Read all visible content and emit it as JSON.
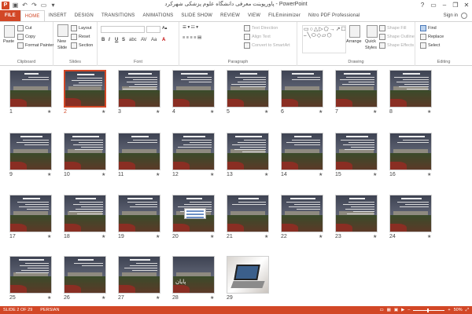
{
  "window": {
    "title": "پاورپوینت معرفی دانشگاه علوم پزشکی شهرکرد - PowerPoint",
    "app_logo": "P",
    "controls": [
      "?",
      "▭",
      "–",
      "❐",
      "✕"
    ]
  },
  "tabs": [
    "FILE",
    "HOME",
    "INSERT",
    "DESIGN",
    "TRANSITIONS",
    "ANIMATIONS",
    "SLIDE SHOW",
    "REVIEW",
    "VIEW",
    "FILEminimizer",
    "Nitro PDF Professional"
  ],
  "account": {
    "signin": "Sign in"
  },
  "ribbon": {
    "clipboard": {
      "label": "Clipboard",
      "paste": "Paste",
      "cut": "Cut",
      "copy": "Copy",
      "format_painter": "Format Painter"
    },
    "slides": {
      "label": "Slides",
      "new_slide": "New",
      "new_slide2": "Slide",
      "layout": "Layout",
      "reset": "Reset",
      "section": "Section"
    },
    "font": {
      "label": "Font",
      "bold": "B",
      "italic": "I",
      "underline": "U",
      "strike": "S",
      "shadow": "abc",
      "spacing": "AV",
      "case": "Aa",
      "color": "A"
    },
    "paragraph": {
      "label": "Paragraph",
      "text_direction": "Text Direction",
      "align_text": "Align Text",
      "convert_smartart": "Convert to SmartArt"
    },
    "drawing": {
      "label": "Drawing",
      "arrange": "Arrange",
      "quick_styles": "Quick",
      "quick_styles2": "Styles",
      "shape_fill": "Shape Fill",
      "shape_outline": "Shape Outline",
      "shape_effects": "Shape Effects"
    },
    "editing": {
      "label": "Editing",
      "find": "Find",
      "replace": "Replace",
      "select": "Select"
    }
  },
  "slides": [
    {
      "num": "1",
      "star": "★"
    },
    {
      "num": "2",
      "star": "★"
    },
    {
      "num": "3",
      "star": "★"
    },
    {
      "num": "4",
      "star": "★"
    },
    {
      "num": "5",
      "star": "★"
    },
    {
      "num": "6",
      "star": "★"
    },
    {
      "num": "7",
      "star": "★"
    },
    {
      "num": "8",
      "star": "★"
    },
    {
      "num": "9",
      "star": "★"
    },
    {
      "num": "10",
      "star": "★"
    },
    {
      "num": "11",
      "star": "★"
    },
    {
      "num": "12",
      "star": "★"
    },
    {
      "num": "13",
      "star": "★"
    },
    {
      "num": "14",
      "star": "★"
    },
    {
      "num": "15",
      "star": "★"
    },
    {
      "num": "16",
      "star": "★"
    },
    {
      "num": "17",
      "star": "★"
    },
    {
      "num": "18",
      "star": "★"
    },
    {
      "num": "19",
      "star": "★"
    },
    {
      "num": "20",
      "star": "★"
    },
    {
      "num": "21",
      "star": "★"
    },
    {
      "num": "22",
      "star": "★"
    },
    {
      "num": "23",
      "star": "★"
    },
    {
      "num": "24",
      "star": "★"
    },
    {
      "num": "25",
      "star": "★"
    },
    {
      "num": "26",
      "star": "★"
    },
    {
      "num": "27",
      "star": "★"
    },
    {
      "num": "28",
      "star": "★"
    },
    {
      "num": "29",
      "star": ""
    }
  ],
  "final_slide_text": "پایان",
  "status": {
    "slide": "SLIDE 2 OF 29",
    "language": "PERSIAN",
    "zoom": "50%"
  },
  "colors": {
    "accent": "#d24726"
  }
}
